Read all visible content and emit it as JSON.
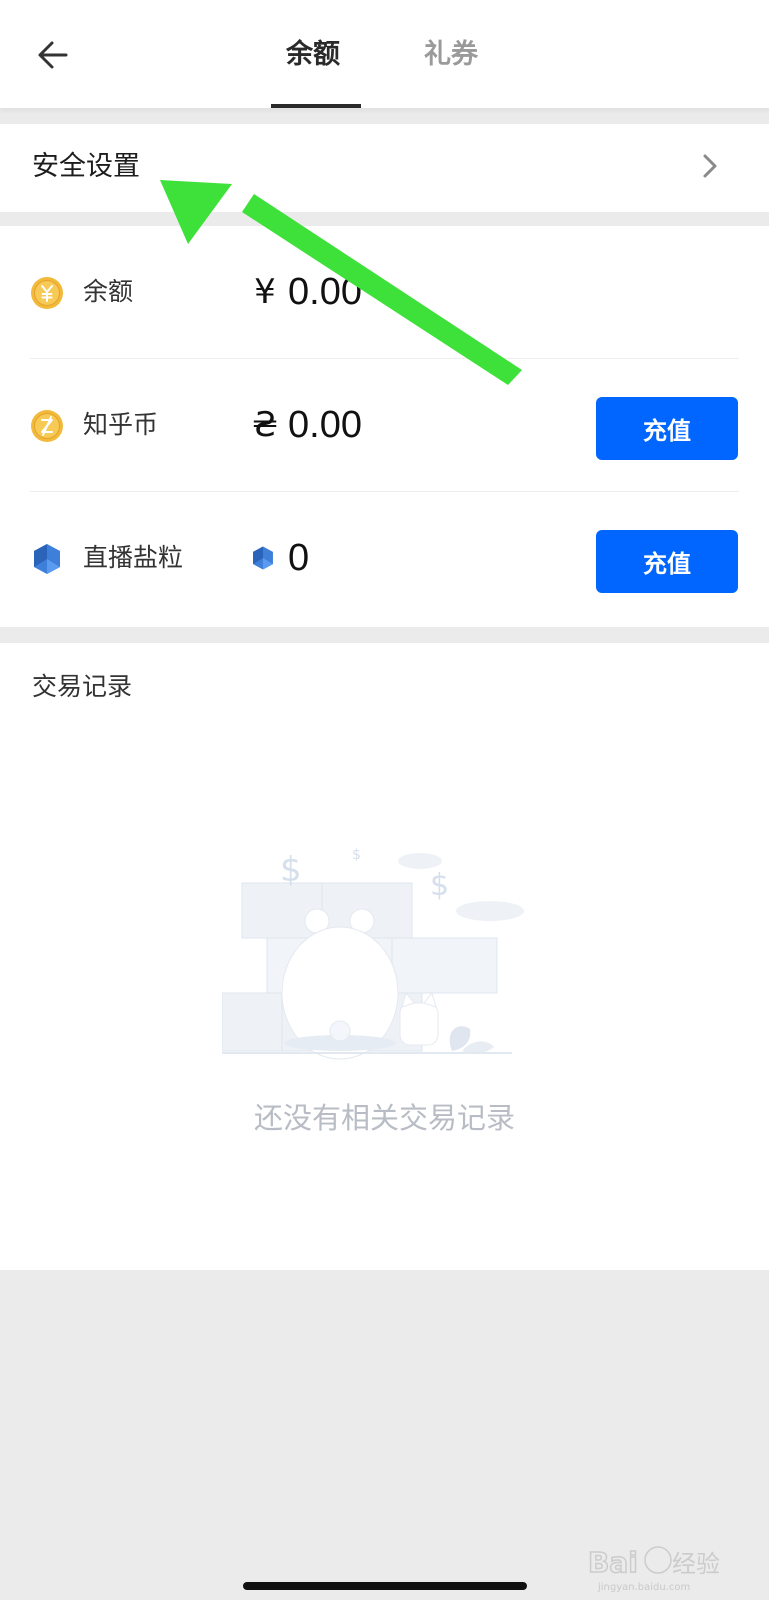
{
  "header": {
    "tabs": [
      {
        "label": "余额",
        "active": true
      },
      {
        "label": "礼券",
        "active": false
      }
    ]
  },
  "security": {
    "label": "安全设置"
  },
  "balances": [
    {
      "label": "余额",
      "symbol": "¥",
      "value": "0.00",
      "icon": "yuan-coin-icon",
      "has_button": false
    },
    {
      "label": "知乎币",
      "symbol": "₴",
      "value": "0.00",
      "icon": "zhihu-coin-icon",
      "has_button": true,
      "button_label": "充值"
    },
    {
      "label": "直播盐粒",
      "symbol": "",
      "value": "0",
      "icon": "salt-crystal-icon",
      "has_button": true,
      "button_label": "充值"
    }
  ],
  "transactions": {
    "title": "交易记录",
    "empty_text": "还没有相关交易记录"
  },
  "watermark": {
    "text": "Baidu经验",
    "url": "jingyan.baidu.com"
  },
  "colors": {
    "accent": "#0066ff",
    "annotation_arrow": "#3ee03a",
    "coin": "#f2b93b",
    "crystal": "#3d7fd9"
  }
}
